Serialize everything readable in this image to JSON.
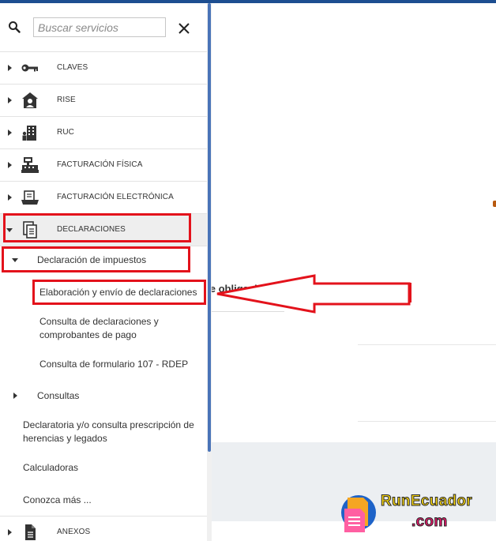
{
  "search": {
    "placeholder": "Buscar servicios"
  },
  "categories": [
    {
      "label": "CLAVES",
      "icon": "key-icon"
    },
    {
      "label": "RISE",
      "icon": "house-user-icon"
    },
    {
      "label": "RUC",
      "icon": "building-icon"
    },
    {
      "label": "FACTURACIÓN FÍSICA",
      "icon": "cash-register-icon"
    },
    {
      "label": "FACTURACIÓN ELECTRÓNICA",
      "icon": "laptop-icon"
    },
    {
      "label": "DECLARACIONES",
      "icon": "document-copy-icon"
    }
  ],
  "declaraciones": {
    "group_label": "Declaración de impuestos",
    "items": [
      "Elaboración y envío de declaraciones",
      "Consulta de declaraciones y",
      "comprobantes de pago",
      "Consulta de formulario 107 - RDEP"
    ],
    "consultas_label": "Consultas",
    "links": [
      "Declaratoria y/o consulta prescripción de",
      "herencias y legados",
      "Calculadoras",
      "Conozca más ..."
    ]
  },
  "anexos": {
    "label": "ANEXOS",
    "icon": "file-text-icon"
  },
  "main": {
    "heading": "Listado de obligaciones"
  },
  "watermark": {
    "line1": "RunEcuador",
    "line2": ".com"
  },
  "colors": {
    "accent": "#1d4e91",
    "scroll": "#4a74b8",
    "highlight": "#e3121b",
    "logo_yellow": "#f6d40e",
    "logo_pink": "#e8166b"
  }
}
